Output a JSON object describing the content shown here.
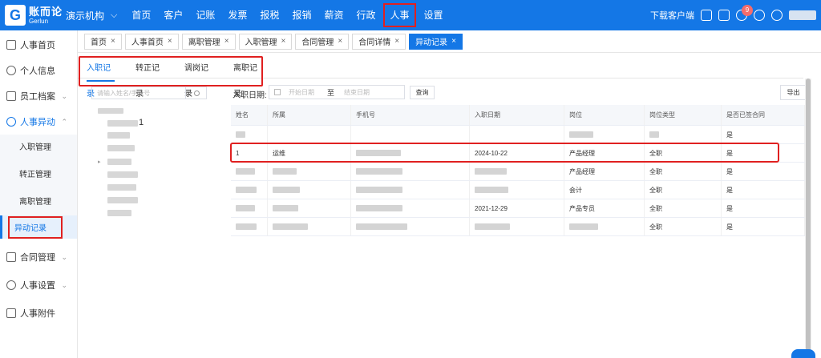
{
  "brand": {
    "cn": "账而论",
    "en": "Gerlun",
    "mark": "G"
  },
  "org": {
    "name": "演示机构"
  },
  "nav": [
    "首页",
    "客户",
    "记账",
    "发票",
    "报税",
    "报销",
    "薪资",
    "行政",
    "人事",
    "设置"
  ],
  "nav_active_index": 8,
  "top_right": {
    "download": "下载客户端",
    "badge_count": "9"
  },
  "sidebar": {
    "items": [
      {
        "label": "人事首页",
        "icon": "home-icon"
      },
      {
        "label": "个人信息",
        "icon": "user-icon"
      },
      {
        "label": "员工档案",
        "icon": "archive-icon",
        "arrow": "⌄"
      },
      {
        "label": "人事异动",
        "icon": "transfer-icon",
        "arrow": "⌃"
      }
    ],
    "subitems": [
      "入职管理",
      "转正管理",
      "离职管理",
      "异动记录"
    ],
    "bottom_items": [
      {
        "label": "合同管理",
        "icon": "contract-icon",
        "arrow": "⌄"
      },
      {
        "label": "人事设置",
        "icon": "gear-icon",
        "arrow": "⌄"
      },
      {
        "label": "人事附件",
        "icon": "folder-icon"
      }
    ]
  },
  "tabs": [
    "首页",
    "人事首页",
    "离职管理",
    "入职管理",
    "合同管理",
    "合同详情",
    "异动记录"
  ],
  "sub_tabs": [
    "入职记录",
    "转正记录",
    "调岗记录",
    "离职记录"
  ],
  "search": {
    "placeholder": "请输入姓名/手机号"
  },
  "tree": {
    "visible_char": "1"
  },
  "filter": {
    "label": "入职日期:",
    "start_placeholder": "开始日期",
    "sep": "至",
    "end_placeholder": "结束日期",
    "query": "查询",
    "export": "导出"
  },
  "table": {
    "headers": [
      "姓名",
      "所属",
      "手机号",
      "入职日期",
      "岗位",
      "岗位类型",
      "是否已签合同"
    ],
    "rows": [
      [
        "",
        "",
        "",
        "",
        "",
        "",
        "是"
      ],
      [
        "1",
        "运维",
        "",
        "2024-10-22",
        "产品经理",
        "全职",
        "是"
      ],
      [
        "",
        "",
        "",
        "",
        "产品经理",
        "全职",
        "是"
      ],
      [
        "",
        "",
        "",
        "",
        "会计",
        "全职",
        "是"
      ],
      [
        "",
        "",
        "",
        "2021-12-29",
        "产品专员",
        "全职",
        "是"
      ],
      [
        "",
        "",
        "",
        "",
        "",
        "全职",
        "是"
      ]
    ]
  }
}
